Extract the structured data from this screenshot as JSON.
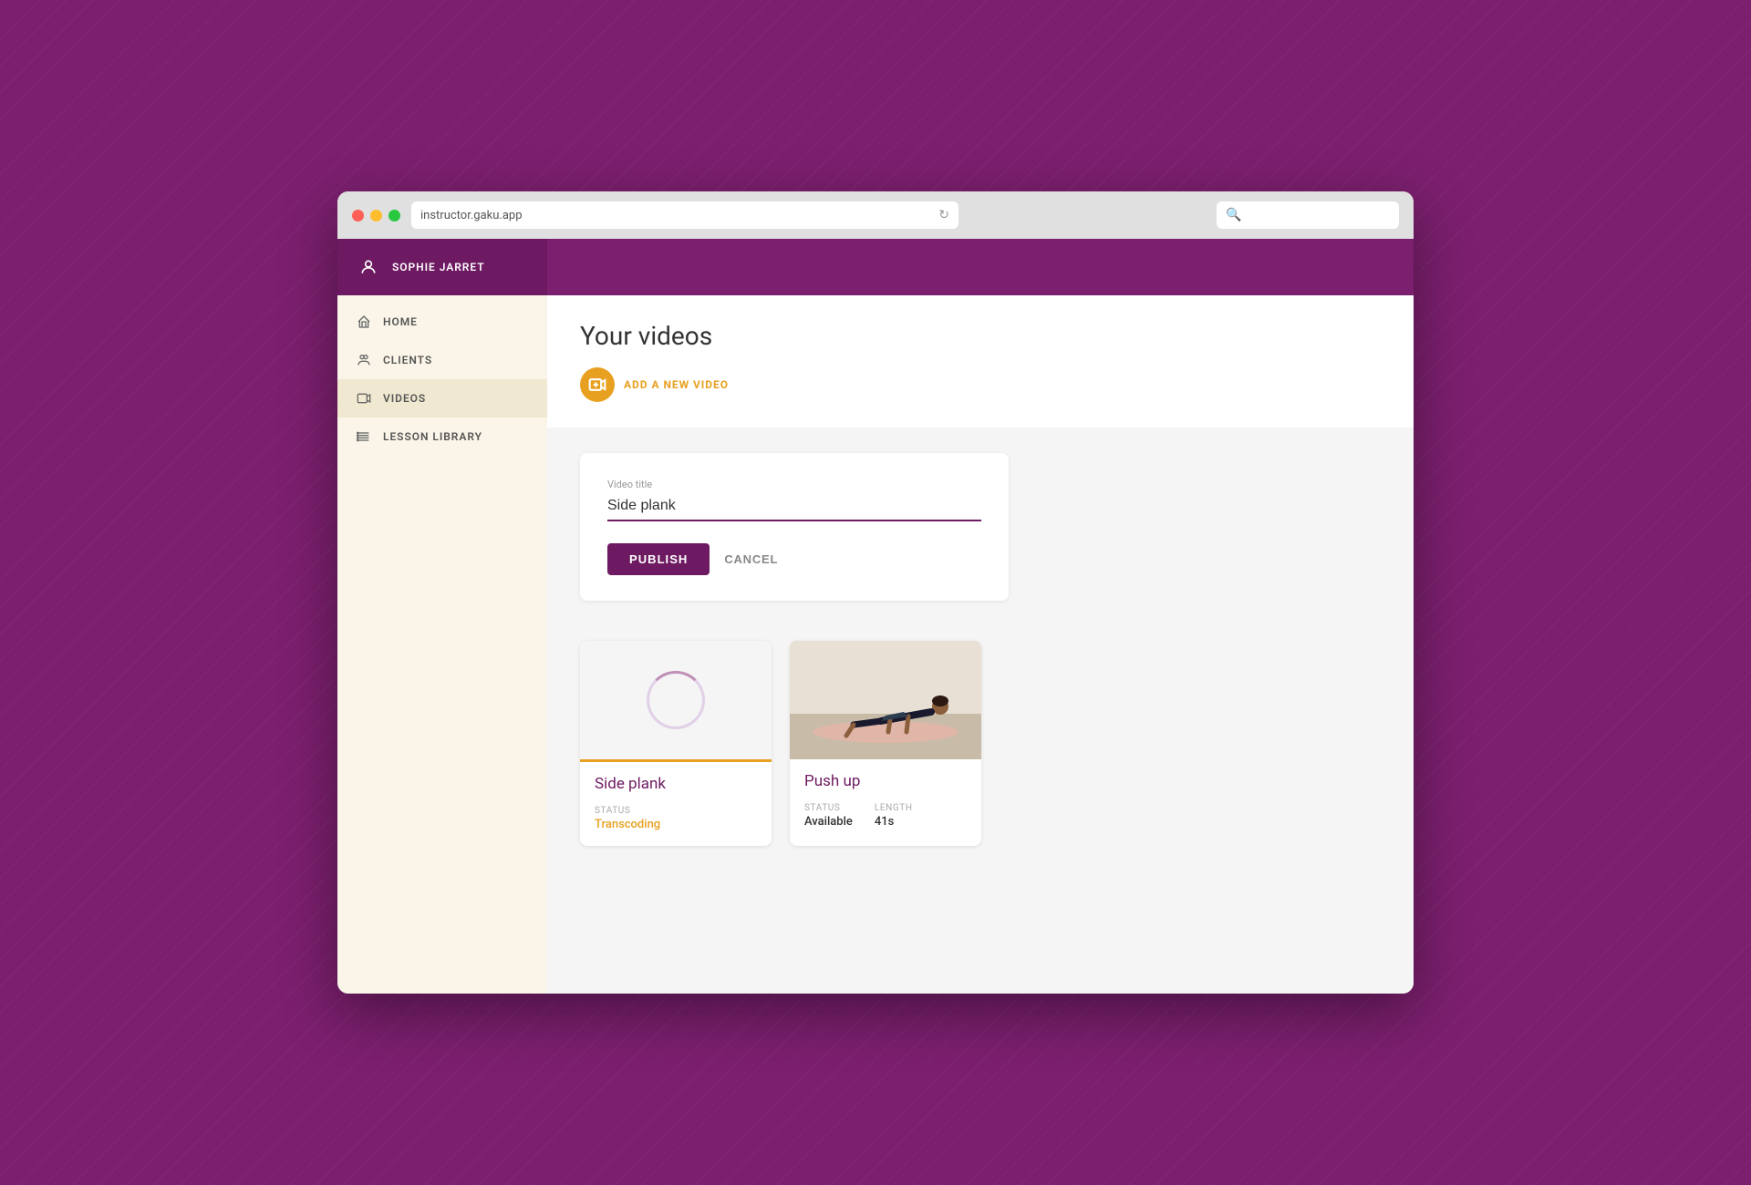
{
  "browser": {
    "url": "instructor.gaku.app",
    "search_placeholder": ""
  },
  "sidebar": {
    "username": "SOPHIE JARRET",
    "nav_items": [
      {
        "id": "home",
        "label": "HOME",
        "icon": "home-icon",
        "active": false
      },
      {
        "id": "clients",
        "label": "CLIENTS",
        "icon": "clients-icon",
        "active": false
      },
      {
        "id": "videos",
        "label": "VIDEOS",
        "icon": "videos-icon",
        "active": true
      },
      {
        "id": "lesson-library",
        "label": "LESSON LIBRARY",
        "icon": "list-icon",
        "active": false
      }
    ]
  },
  "main": {
    "page_title": "Your videos",
    "add_video_label": "ADD A NEW VIDEO",
    "form": {
      "field_label": "Video title",
      "field_value": "Side plank",
      "publish_label": "PUBLISH",
      "cancel_label": "CANCEL"
    },
    "videos": [
      {
        "id": "side-plank",
        "title": "Side plank",
        "status_label": "STATUS",
        "status_value": "Transcoding",
        "status_type": "transcoding",
        "has_image": false
      },
      {
        "id": "push-up",
        "title": "Push up",
        "status_label": "STATUS",
        "status_value": "Available",
        "length_label": "LENGTH",
        "length_value": "41s",
        "has_image": true
      }
    ]
  }
}
